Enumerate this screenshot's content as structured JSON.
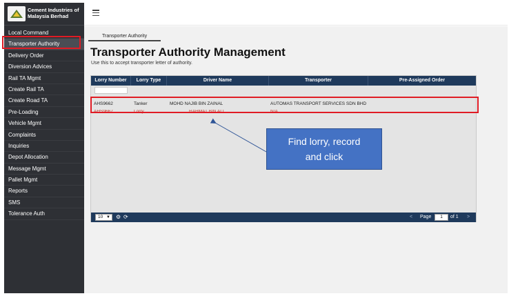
{
  "brand": {
    "name_line1": "Cement Industries of",
    "name_line2": "Malaysia Berhad"
  },
  "sidebar": {
    "items": [
      {
        "label": "Local Command"
      },
      {
        "label": "Transporter Authority"
      },
      {
        "label": "Delivery Order"
      },
      {
        "label": "Diversion Advices"
      },
      {
        "label": "Rail TA Mgmt"
      },
      {
        "label": "Create Rail TA"
      },
      {
        "label": "Create Road TA"
      },
      {
        "label": "Pre-Loading"
      },
      {
        "label": "Vehicle Mgmt"
      },
      {
        "label": "Complaints"
      },
      {
        "label": "Inquiries"
      },
      {
        "label": "Depot Allocation"
      },
      {
        "label": "Message Mgmt"
      },
      {
        "label": "Pallet Mgmt"
      },
      {
        "label": "Reports"
      },
      {
        "label": "SMS"
      },
      {
        "label": "Tolerance Auth"
      }
    ],
    "active": "Transporter Authority"
  },
  "main": {
    "tab_label": "Transporter Authority",
    "title": "Transporter Authority Management",
    "subtitle": "Use this to accept transporter letter of authority."
  },
  "grid": {
    "columns": [
      "Lorry Number",
      "Lorry Type",
      "Driver Name",
      "Transporter",
      "Pre-Assigned Order"
    ],
    "rows": [
      {
        "lorry_number": "AHS9662",
        "lorry_type": "Tanker",
        "driver_name": "MOHD NAJIB BIN ZAINAL",
        "transporter": "AUTOMAS TRANSPORT SERVICES SDN BHD",
        "pre_assigned_order": ""
      },
      {
        "lorry_number": "AHS9667",
        "lorry_type": "Lorry",
        "driver_name": "RAHMAT BIN ALI",
        "transporter": "N/A",
        "pre_assigned_order": ""
      }
    ],
    "page_size": "10",
    "page_label": "Page",
    "page_number": "1",
    "page_of": "of 1",
    "prev_icon": "<",
    "next_icon": ">"
  },
  "annotation": {
    "line1": "Find lorry, record",
    "line2": "and click"
  },
  "colors": {
    "sidebar_bg": "#2e3035",
    "grid_header": "#1f3a5c",
    "highlight_red": "#e01b24",
    "callout_blue": "#4472c4"
  },
  "icons": {
    "menu": "hamburger-icon",
    "settings": "gear-icon",
    "refresh": "refresh-icon"
  }
}
